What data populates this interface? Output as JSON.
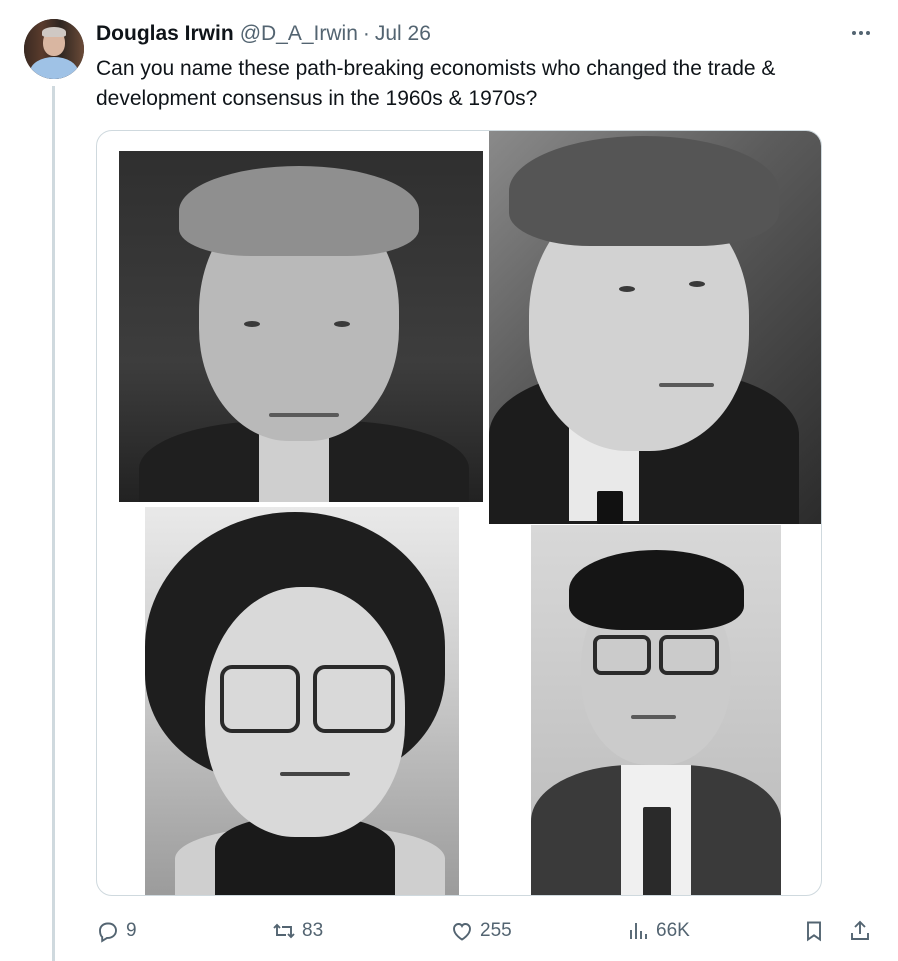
{
  "tweet": {
    "author_name": "Douglas Irwin",
    "author_handle": "@D_A_Irwin",
    "separator": "·",
    "date": "Jul 26",
    "text": "Can you name these path-breaking economists who changed the trade & development consensus in the 1960s & 1970s?"
  },
  "media": {
    "photos": [
      {
        "description_icon": "photo-portrait"
      },
      {
        "description_icon": "photo-portrait"
      },
      {
        "description_icon": "photo-portrait"
      },
      {
        "description_icon": "photo-portrait"
      }
    ]
  },
  "actions": {
    "replies": "9",
    "reposts": "83",
    "likes": "255",
    "views": "66K"
  },
  "icons": {
    "reply": "reply-icon",
    "repost": "repost-icon",
    "like": "heart-icon",
    "views": "views-icon",
    "bookmark": "bookmark-icon",
    "share": "share-icon",
    "more": "more-icon"
  },
  "colors": {
    "text_primary": "#0f1419",
    "text_secondary": "#536471",
    "border": "#cfd9de"
  }
}
